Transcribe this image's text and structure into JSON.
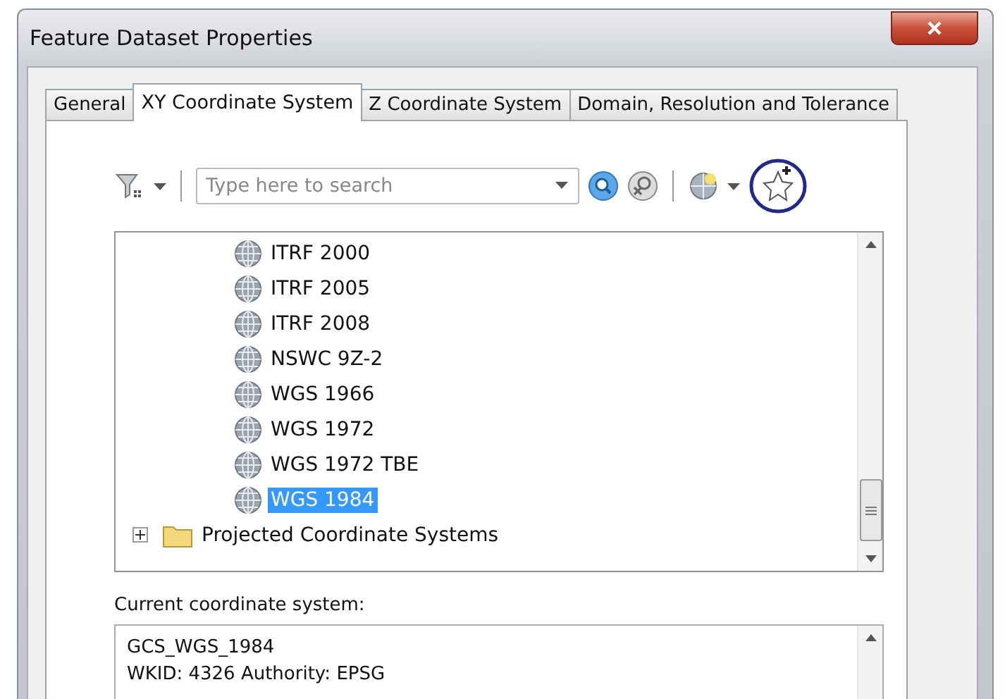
{
  "window": {
    "title": "Feature Dataset Properties"
  },
  "tabs": [
    {
      "label": "General",
      "selected": false
    },
    {
      "label": "XY Coordinate System",
      "selected": true
    },
    {
      "label": "Z Coordinate System",
      "selected": false
    },
    {
      "label": "Domain, Resolution and Tolerance",
      "selected": false
    }
  ],
  "search": {
    "placeholder": "Type here to search"
  },
  "tree": {
    "items": [
      {
        "label": "ITRF 2000",
        "kind": "globe",
        "selected": false
      },
      {
        "label": "ITRF 2005",
        "kind": "globe",
        "selected": false
      },
      {
        "label": "ITRF 2008",
        "kind": "globe",
        "selected": false
      },
      {
        "label": "NSWC 9Z-2",
        "kind": "globe",
        "selected": false
      },
      {
        "label": "WGS 1966",
        "kind": "globe",
        "selected": false
      },
      {
        "label": "WGS 1972",
        "kind": "globe",
        "selected": false
      },
      {
        "label": "WGS 1972 TBE",
        "kind": "globe",
        "selected": false
      },
      {
        "label": "WGS 1984",
        "kind": "globe",
        "selected": true
      },
      {
        "label": "Projected Coordinate Systems",
        "kind": "folder",
        "selected": false,
        "expanded": false
      }
    ]
  },
  "current": {
    "label": "Current coordinate system:",
    "lines": [
      "GCS_WGS_1984",
      "WKID: 4326 Authority: EPSG"
    ]
  }
}
